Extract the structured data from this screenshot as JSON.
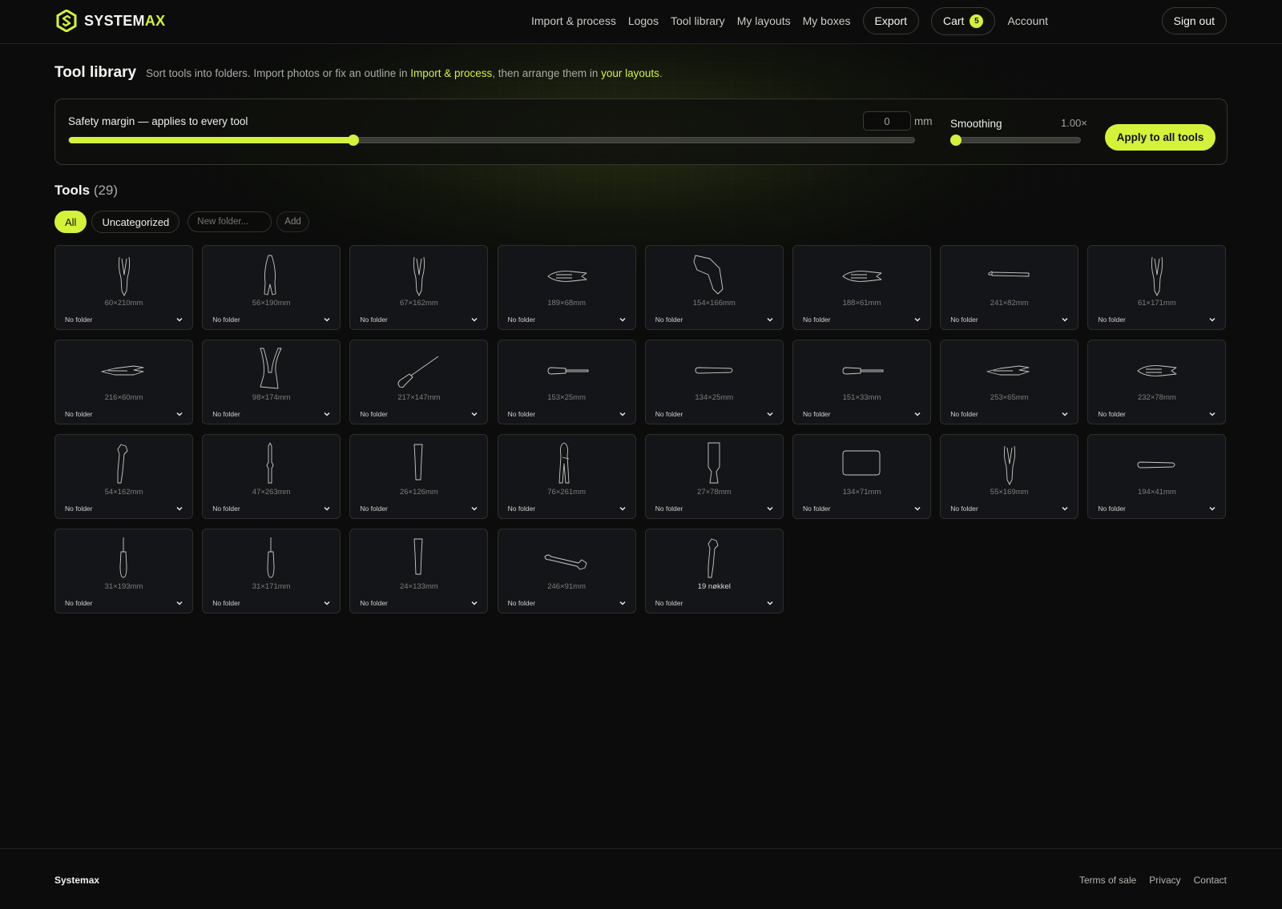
{
  "brand": {
    "name_main": "SYSTEM",
    "name_accent": "AX",
    "accent_color": "#d4f23a"
  },
  "nav": {
    "links": [
      "Import & process",
      "Logos",
      "Tool library",
      "My layouts",
      "My boxes"
    ],
    "export_label": "Export",
    "cart_label": "Cart",
    "cart_count": "5",
    "account_label": "Account",
    "signout_label": "Sign out"
  },
  "page": {
    "title": "Tool library",
    "subtitle_pre": "Sort tools into folders. Import photos or fix an outline in ",
    "subtitle_link1": "Import & process",
    "subtitle_mid": ", then arrange them in ",
    "subtitle_link2": "your layouts",
    "subtitle_post": "."
  },
  "settings": {
    "margin_label": "Safety margin — applies to every tool",
    "margin_value": "0",
    "margin_unit": "mm",
    "margin_slider_fraction": 0.336,
    "smoothing_label": "Smoothing",
    "smoothing_value": "1.00×",
    "smoothing_slider_fraction": 0.0,
    "apply_label": "Apply to all tools"
  },
  "tools": {
    "title": "Tools",
    "count": "(29)",
    "filter_all": "All",
    "filter_uncategorized": "Uncategorized",
    "new_folder_placeholder": "New folder...",
    "add_label": "Add",
    "items": [
      {
        "label": "60×210mm",
        "folder": "No folder",
        "shape": "pliers-v"
      },
      {
        "label": "56×190mm",
        "folder": "No folder",
        "shape": "cutter-v"
      },
      {
        "label": "67×162mm",
        "folder": "No folder",
        "shape": "pliers-v"
      },
      {
        "label": "189×68mm",
        "folder": "No folder",
        "shape": "pliers-h"
      },
      {
        "label": "154×166mm",
        "folder": "No folder",
        "shape": "bent"
      },
      {
        "label": "188×61mm",
        "folder": "No folder",
        "shape": "pliers-h"
      },
      {
        "label": "241×82mm",
        "folder": "No folder",
        "shape": "hammer"
      },
      {
        "label": "61×171mm",
        "folder": "No folder",
        "shape": "pliers-v"
      },
      {
        "label": "216×60mm",
        "folder": "No folder",
        "shape": "pliers-h-long"
      },
      {
        "label": "98×174mm",
        "folder": "No folder",
        "shape": "cutter-wide"
      },
      {
        "label": "217×147mm",
        "folder": "No folder",
        "shape": "screwdriver-diag"
      },
      {
        "label": "153×25mm",
        "folder": "No folder",
        "shape": "screwdriver-h"
      },
      {
        "label": "134×25mm",
        "folder": "No folder",
        "shape": "bar-h"
      },
      {
        "label": "151×33mm",
        "folder": "No folder",
        "shape": "screwdriver-h"
      },
      {
        "label": "253×65mm",
        "folder": "No folder",
        "shape": "pliers-h-long"
      },
      {
        "label": "232×78mm",
        "folder": "No folder",
        "shape": "pliers-h"
      },
      {
        "label": "54×162mm",
        "folder": "No folder",
        "shape": "wrench-v"
      },
      {
        "label": "47×263mm",
        "folder": "No folder",
        "shape": "file-v"
      },
      {
        "label": "26×126mm",
        "folder": "No folder",
        "shape": "chisel-v"
      },
      {
        "label": "76×261mm",
        "folder": "No folder",
        "shape": "pump-pliers"
      },
      {
        "label": "27×78mm",
        "folder": "No folder",
        "shape": "knife-v"
      },
      {
        "label": "134×71mm",
        "folder": "No folder",
        "shape": "box"
      },
      {
        "label": "55×169mm",
        "folder": "No folder",
        "shape": "pliers-v"
      },
      {
        "label": "194×41mm",
        "folder": "No folder",
        "shape": "bar-h"
      },
      {
        "label": "31×193mm",
        "folder": "No folder",
        "shape": "screwdriver-v"
      },
      {
        "label": "31×171mm",
        "folder": "No folder",
        "shape": "screwdriver-v"
      },
      {
        "label": "24×133mm",
        "folder": "No folder",
        "shape": "chisel-v"
      },
      {
        "label": "246×91mm",
        "folder": "No folder",
        "shape": "wrench-h"
      },
      {
        "label": "19 nøkkel",
        "folder": "No folder",
        "shape": "wrench-v"
      }
    ]
  },
  "footer": {
    "brand": "Systemax",
    "links": [
      "Terms of sale",
      "Privacy",
      "Contact"
    ]
  }
}
